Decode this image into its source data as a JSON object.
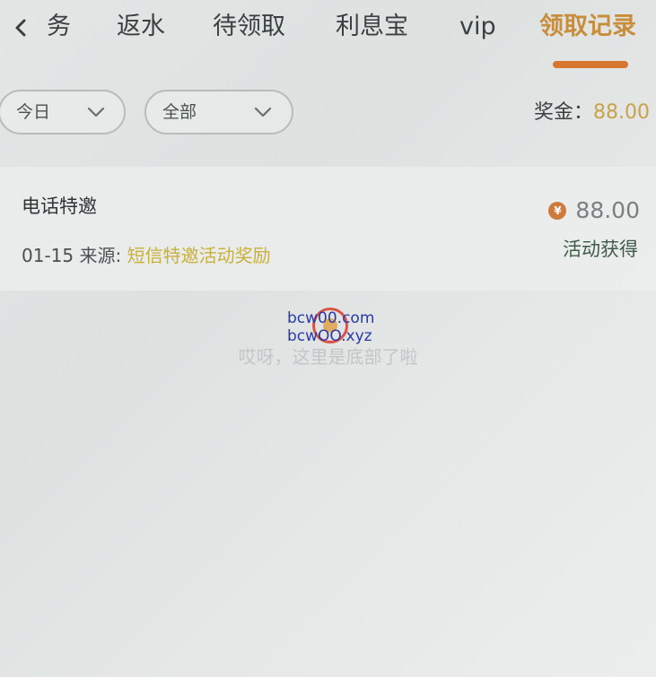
{
  "tabs": [
    {
      "label": "务"
    },
    {
      "label": "返水"
    },
    {
      "label": "待领取"
    },
    {
      "label": "利息宝"
    },
    {
      "label": "vip"
    },
    {
      "label": "领取记录",
      "active": true
    }
  ],
  "filters": {
    "date": {
      "value": "今日"
    },
    "type": {
      "value": "全部"
    }
  },
  "bonus": {
    "label": "奖金：",
    "value": "88.00"
  },
  "record": {
    "title": "电话特邀",
    "date": "01-15",
    "source_label": "来源:",
    "source_value": "短信特邀活动奖励",
    "amount": "88.00",
    "status": "活动获得"
  },
  "watermark": {
    "line1": "bcw00.com",
    "line2": "bcwOO.xyz"
  },
  "end_note": "哎呀，这里是底部了啦",
  "colors": {
    "accent": "#c98d3a",
    "underline": "#d7762e",
    "status": "#3f5b49",
    "source": "#c9b03a"
  }
}
